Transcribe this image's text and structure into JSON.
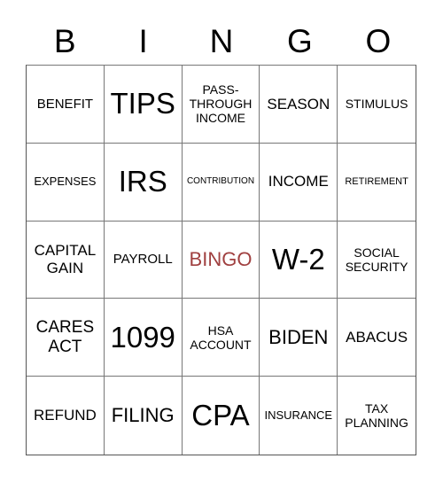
{
  "header": [
    "B",
    "I",
    "N",
    "G",
    "O"
  ],
  "free_color": "#a04040",
  "cells": [
    "BENEFIT",
    "TIPS",
    "PASS-THROUGH INCOME",
    "SEASON",
    "STIMULUS",
    "EXPENSES",
    "IRS",
    "CONTRIBUTION",
    "INCOME",
    "RETIREMENT",
    "CAPITAL GAIN",
    "PAYROLL",
    "BINGO",
    "W-2",
    "SOCIAL SECURITY",
    "CARES ACT",
    "1099",
    "HSA ACCOUNT",
    "BIDEN",
    "ABACUS",
    "REFUND",
    "FILING",
    "CPA",
    "INSURANCE",
    "TAX PLANNING"
  ]
}
